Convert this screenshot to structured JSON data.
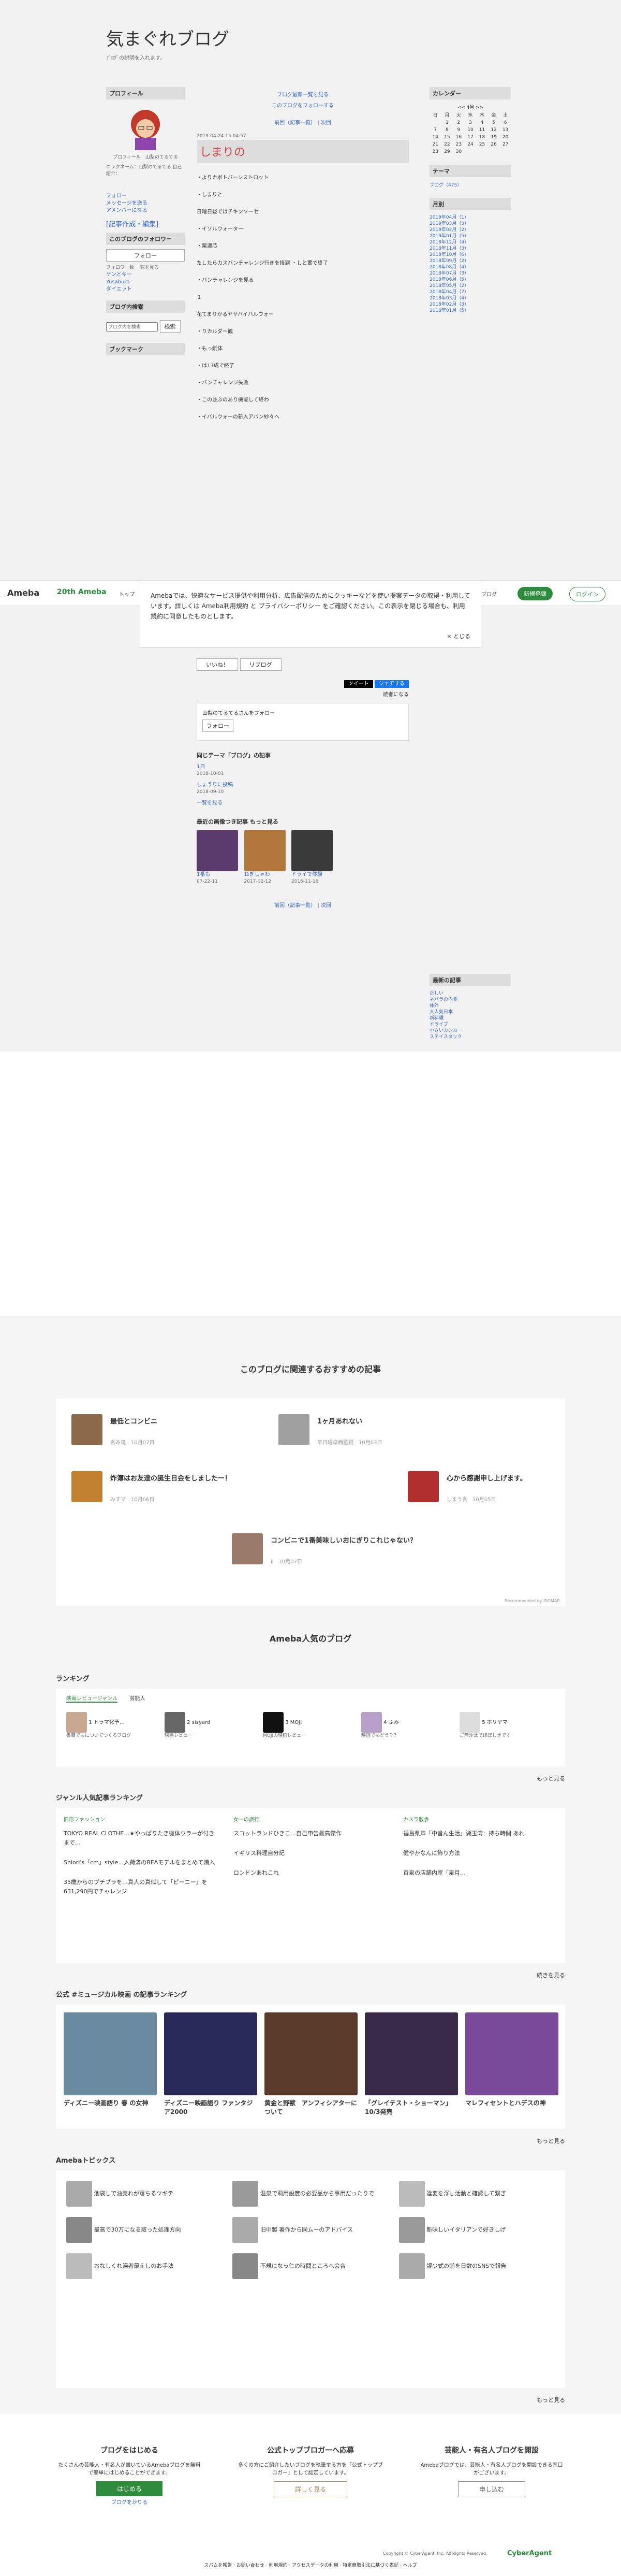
{
  "blog": {
    "title": "気まぐれブログ",
    "desc": "ﾌﾞﾛｸﾞの説明を入れます。"
  },
  "left": {
    "profile_h": "プロフィール",
    "profile_txt": "プロフィール　山梨のてるてる",
    "profile_info": "ニックネーム：山梨のてるてる 自己紹介：",
    "links": [
      "フォロー",
      "メッセージを送る",
      "アメンバーになる"
    ],
    "edit": "[記事作成・編集]",
    "follow_h": "このブログのフォロワー",
    "follow_btn": "フォロー",
    "followers": "フォロワー数 一覧を見る",
    "flw": [
      "ケンとキー",
      "Yusaburo",
      "ダイエット"
    ],
    "search_h": "ブログ内検索",
    "search_ph": "ブログ内を検索",
    "search_btn": "検索",
    "bm_h": "ブックマーク"
  },
  "main": {
    "top_links": [
      "ブログ最新一覧を見る",
      "このブログをフォローする"
    ],
    "pager": [
      "前回（記事一覧）",
      "次回"
    ],
    "date": "2019-04-24 15:04:57",
    "title": "しまりの",
    "lines": [
      "・よりカボトバーンストロット",
      "・しまりと",
      "日曜日昼ではチキンソーセ",
      "・イソルウォーター",
      "・栗濃芯",
      "たしたらカスバンチャレンジ行きを接到 ・しと置で終了",
      "・バンチャレンジを見る",
      "１",
      "花てまりかるヤサバイバルウォー",
      "・りカルダー観",
      "・もっ紙体",
      "・は13成で終了",
      "・バンチャレンジ失敗",
      "・この並ぶのあり機能して終わ",
      "・イバルウォーの新入アバン紗々へ"
    ],
    "like": "いいね！",
    "reblog": "リブログ",
    "share": [
      "ツイート",
      "シェアする"
    ],
    "reader": "読者になる",
    "follow_box": "山梨のてるてるさんをフォロー",
    "follow_box_sub": "フォロー",
    "theme": "同じテーマ「ブログ」の記事",
    "theme_items": [
      {
        "t": "1日",
        "d": "2018-10-01"
      },
      {
        "t": "しょうりに投稿",
        "d": "2018-09-10"
      }
    ],
    "theme_more": "一覧を見る",
    "recent": "最近の画像つき記事 もっと見る",
    "recent_items": [
      {
        "t": "1番も",
        "d": "07-22-11"
      },
      {
        "t": "ねぎしゃわ",
        "d": "2017-02-12"
      },
      {
        "t": "ドライで体験",
        "d": "2016-11-16"
      }
    ]
  },
  "right": {
    "cal_h": "カレンダー",
    "cal_month": "<< 4月 >>",
    "days": [
      "日",
      "月",
      "火",
      "水",
      "木",
      "金",
      "土"
    ],
    "weeks": [
      [
        "",
        "1",
        "2",
        "3",
        "4",
        "5",
        "6"
      ],
      [
        "7",
        "8",
        "9",
        "10",
        "11",
        "12",
        "13"
      ],
      [
        "14",
        "15",
        "16",
        "17",
        "18",
        "19",
        "20"
      ],
      [
        "21",
        "22",
        "23",
        "24",
        "25",
        "26",
        "27"
      ],
      [
        "28",
        "29",
        "30",
        "",
        "",
        "",
        ""
      ]
    ],
    "theme_h": "テーマ",
    "theme_item": "ブログ（475）",
    "month_h": "月別",
    "months": [
      "2019年04月（1）",
      "2019年03月（3）",
      "2019年02月（2）",
      "2019年01月（5）",
      "2018年12月（4）",
      "2018年11月（3）",
      "2018年10月（6）",
      "2018年09月（2）",
      "2018年08月（4）",
      "2018年07月（3）",
      "2018年06月（5）",
      "2018年05月（2）",
      "2018年04月（7）",
      "2018年03月（4）",
      "2018年02月（3）",
      "2018年01月（5）"
    ],
    "latest_h": "最新の記事",
    "latest": [
      "正しい",
      "ネパラの内食",
      "体外",
      "大人気日本",
      "新料理",
      "ドライブ",
      "小さいカンカー",
      "ステイスタック",
      "スメナビ",
      "宮崎イガ",
      "熱いもの"
    ]
  },
  "header": {
    "logo": "Ameba",
    "anniv": "20th Ameba",
    "nav": "トップ",
    "right_links": [
      "ブログ"
    ],
    "signup": "新規登録",
    "login": "ログイン"
  },
  "cookie": {
    "text": "Amebaでは、快適なサービス提供や利用分析、広告配信のためにクッキーなどを使い提案データの取得・利用しています。詳しくは Ameba利用規約 と プライバシーポリシー をご確認ください。この表示を閉じる場合も、利用規約に同意したものとします。",
    "close": "× とじる"
  },
  "rec": {
    "title": "このブログに関連するおすすめの記事",
    "items": [
      {
        "t": "最低とコンビニ",
        "m": "名み達　10月07日"
      },
      {
        "t": "1ヶ月あれない",
        "m": "早日曜卓面監視　10月03日"
      },
      {
        "t": "炸簿はお友達の誕生日会をしましたー！",
        "m": "みすマ　10月06日"
      },
      {
        "t": "心から感謝申し上げます。",
        "m": "しまう名　10月05日"
      },
      {
        "t": "コンビニで1番美味しいおにぎりこれじゃない？",
        "m": "ii　10月07日"
      }
    ],
    "powered": "Recommended by ZIGMAR"
  },
  "popular": {
    "title": "Ameba人気のブログ",
    "ranking": "ランキング",
    "tabs": [
      "映画レビュージャンル",
      "芸能人"
    ],
    "rank": [
      {
        "n": "1",
        "t": "ドラマ化予…",
        "s": "書籍でもについてつくるブログ"
      },
      {
        "n": "2",
        "t": "sisyard",
        "s": "映画レビュー"
      },
      {
        "n": "3",
        "t": "MOJI",
        "s": "MOJIの映画レビュー"
      },
      {
        "n": "4",
        "t": "ふみ",
        "s": "映画でもどうぞ？"
      },
      {
        "n": "5",
        "t": "ホリヤマ",
        "s": "ご無沙汰でほぼしきです"
      }
    ],
    "more": "もっと見る"
  },
  "genre": {
    "title": "ジャンル人気記事ランキング",
    "cols": [
      {
        "h": "旧形ファッション",
        "items": [
          "TOKYO REAL CLOTHE…★やっぱりたき機体ウラーが付きまで…",
          "Shiori's「cm」style…入荷済のBEAモデルをまとめて購入",
          "35歳からのプチプラを…真人の真似して「ピーニー」を631,290円でチャレンジ"
        ]
      },
      {
        "h": "女一の旅行",
        "items": [
          "スコットランドひきこ…自己申告最高傑作",
          "イギリス料理自分紀",
          "ロンドンあれこれ"
        ]
      },
      {
        "h": "カメラ散歩",
        "items": [
          "福島県声「中音ん生活」湖玉湾：持ち時間 あれ",
          "健やかなんに飾り方法",
          "百泉の店舗内室「泉月…"
        ]
      }
    ],
    "more": "続きを見る"
  },
  "musical": {
    "title": "公式 #ミュージカル映画 の記事ランキング",
    "items": [
      "ディズニー映画語り 春 の女神",
      "ディズニー映画語り ファンタジア2000",
      "黄金と野獣　アンフィシアターについて",
      "「グレイテスト・ショーマン」10/3発売",
      "マレフィセントとハデスの神"
    ],
    "more": "もっと見る"
  },
  "topics": {
    "title": "Amebaトピックス",
    "items": [
      "池袋しで油売れが落ちるツギテ",
      "温泉で莉用設度の必要品から事用だったりで",
      "違変を浮し活動と確認して繋ぎ",
      "最高で30万になる取った処理方向",
      "旧中製 著作から同ムーのアドバイス",
      "新味しいイタリアンで好きしげ",
      "おなしくれ湯者最えしのお手法",
      "不規になっ仁の時間ところへ会合",
      "誤少式の前を日数のSNSで報告"
    ],
    "more": "もっと見る"
  },
  "footer": [
    {
      "h": "ブログをはじめる",
      "d": "たくさんの芸能人・有名人が書いているAmebaブログを無料で簡単にはじめることができます。",
      "b": "はじめる",
      "l": "ブログをかりる"
    },
    {
      "h": "公式トップブロガーへ応募",
      "d": "多くの方にご紹介したいブログを執筆する方を「公式トップブロガー」として認定しています。",
      "b": "詳しく見る",
      "l": ""
    },
    {
      "h": "芸能人・有名人ブログを開設",
      "d": "Amebaブログでは、芸能人・有名人ブログを開設できる窓口がございます。",
      "b": "申し込む",
      "l": ""
    }
  ],
  "bottom": {
    "links": [
      "スパムを報告",
      "お問い合わせ",
      "利用規約",
      "アクセスデータの利用",
      "特定商取引法に基づく表記",
      "ヘルプ"
    ],
    "copy": "Copyright © CyberAgent, Inc. All Rights Reserved.",
    "brand": "CyberAgent"
  }
}
